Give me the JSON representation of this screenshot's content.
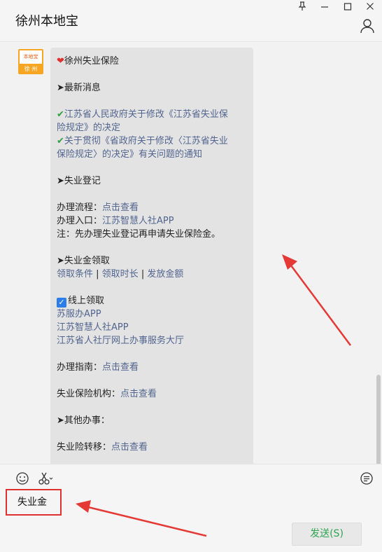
{
  "window": {
    "title": "徐州本地宝",
    "pin_icon": "pin-icon",
    "min_icon": "minimize-icon",
    "max_icon": "maximize-icon",
    "close_icon": "close-icon"
  },
  "avatar": {
    "top_text": "本地宝",
    "bottom_text": "徐 州"
  },
  "message": {
    "header": "徐州失业保险",
    "section_news": "➤最新消息",
    "news_1_line1": "江苏省人民政府关于修改《江苏省失业保",
    "news_1_line2": "险规定》的决定",
    "news_2_line1": "关于贯彻《省政府关于修改〈江苏省失业",
    "news_2_line2": "保险规定〉的决定》有关问题的通知",
    "section_register": "➤失业登记",
    "process_label": "办理流程：",
    "process_link": "点击查看",
    "entry_label": "办理入口：",
    "entry_link": "江苏智慧人社APP",
    "note": "注：先办理失业登记再申请失业保险金。",
    "section_benefit": "➤失业金领取",
    "benefit_link_1": "领取条件",
    "benefit_link_2": "领取时长",
    "benefit_link_3": "发放金额",
    "separator": " | ",
    "online_label": "线上领取",
    "online_1": "苏服办APP",
    "online_2": "江苏智慧人社APP",
    "online_3": " 江苏省人社厅网上办事服务大厅",
    "guide_label": "办理指南：",
    "guide_link": "点击查看",
    "agency_label": "失业保险机构：",
    "agency_link": "点击查看",
    "section_other": "➤其他办事：",
    "transfer_label": "失业险转移：",
    "transfer_link": "点击查看"
  },
  "input": {
    "value": "失业金"
  },
  "send_button": {
    "label": "发送(S)"
  },
  "colors": {
    "accent_green": "#2ea44f",
    "link": "#52658f",
    "annotation_red": "#e03131"
  }
}
